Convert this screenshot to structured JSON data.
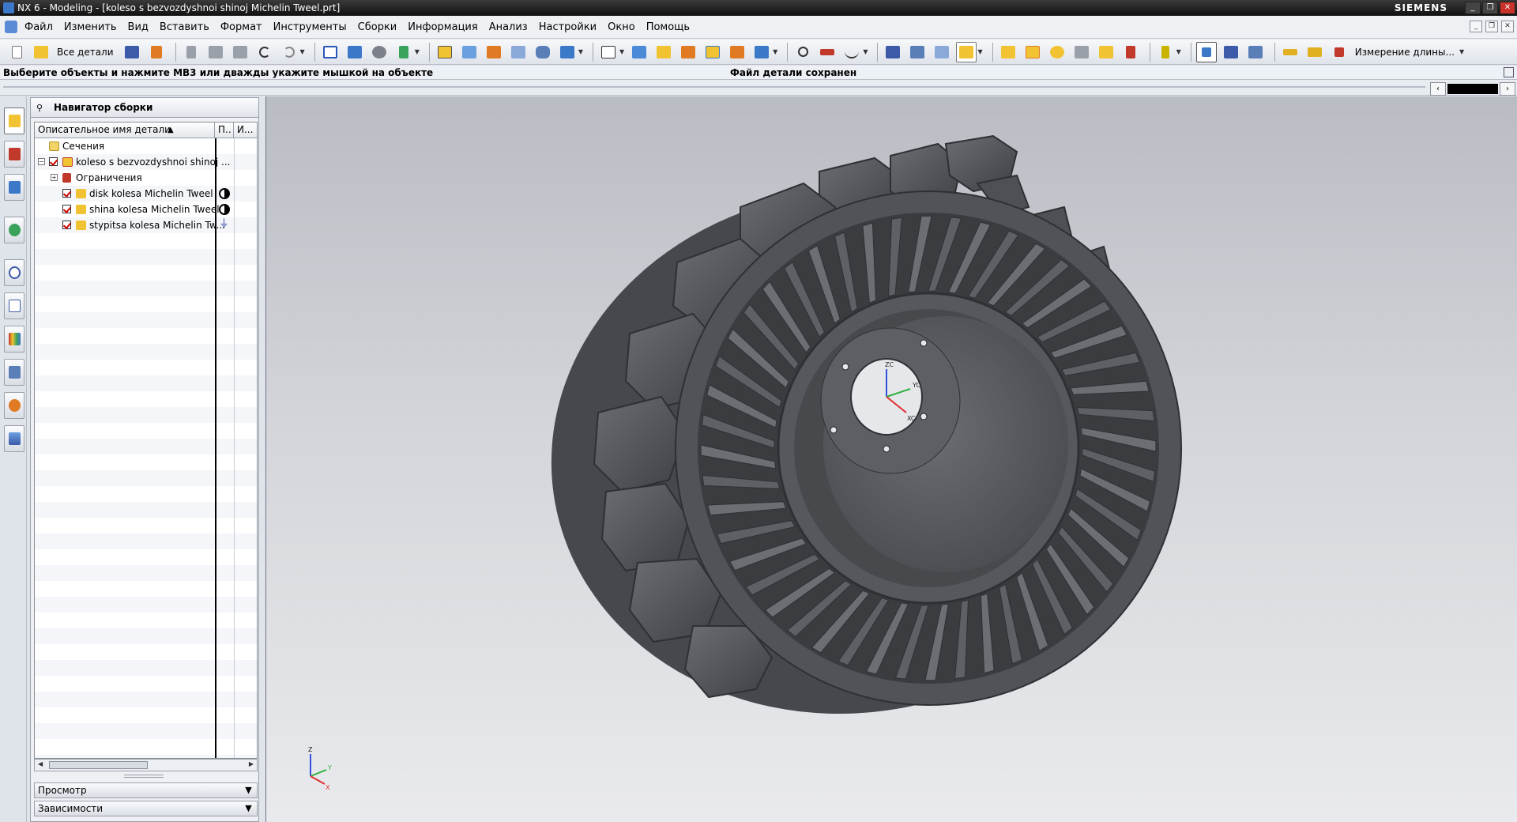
{
  "window": {
    "title": "NX 6 - Modeling - [koleso s bezvozdyshnoi shinoj Michelin Tweel.prt]",
    "brand": "SIEMENS",
    "controls": [
      "_",
      "❐",
      "✕"
    ]
  },
  "menu": {
    "items": [
      "Файл",
      "Изменить",
      "Вид",
      "Вставить",
      "Формат",
      "Инструменты",
      "Сборки",
      "Информация",
      "Анализ",
      "Настройки",
      "Окно",
      "Помощь"
    ]
  },
  "toolbar": {
    "filter_label": "Все детали",
    "measure_label": "Измерение длины...",
    "icon_colors": {
      "blue": "#3c78c8",
      "yellow": "#f1c232",
      "orange": "#e07b24",
      "red": "#c0392b",
      "green": "#3aa35b",
      "gray": "#7b8089"
    }
  },
  "status": {
    "cue": "Выберите объекты и нажмите MB3 или дважды укажите мышкой на объекте",
    "message": "Файл детали сохранен"
  },
  "navigator": {
    "title": "Навигатор сборки",
    "columns": [
      "Описательное имя детали",
      "П..",
      "И..."
    ],
    "rows": [
      {
        "label": "Сечения",
        "icon": "folder-icon"
      },
      {
        "label": "koleso s bezvozdyshnoi shinoj ...",
        "icon": "assembly-icon",
        "checked": true
      },
      {
        "label": "Ограничения",
        "icon": "constraints-icon"
      },
      {
        "label": "disk kolesa Michelin Tweel",
        "icon": "part-icon",
        "checked": true,
        "state": "half-circle"
      },
      {
        "label": "shina kolesa Michelin Tweel",
        "icon": "part-icon",
        "checked": true,
        "state": "half-circle"
      },
      {
        "label": "stypitsa kolesa Michelin Tw...",
        "icon": "part-icon",
        "checked": true,
        "state": "constraint"
      }
    ],
    "panels": [
      "Просмотр",
      "Зависимости"
    ]
  },
  "viewport": {
    "csys_labels": {
      "z": "ZC",
      "y": "YC",
      "x": "XC"
    },
    "triad_labels": {
      "z": "Z",
      "y": "Y",
      "x": "X"
    },
    "colors": {
      "axis_x": "#e03030",
      "axis_y": "#30b040",
      "axis_z": "#3050e0",
      "model": "#55585d"
    }
  }
}
